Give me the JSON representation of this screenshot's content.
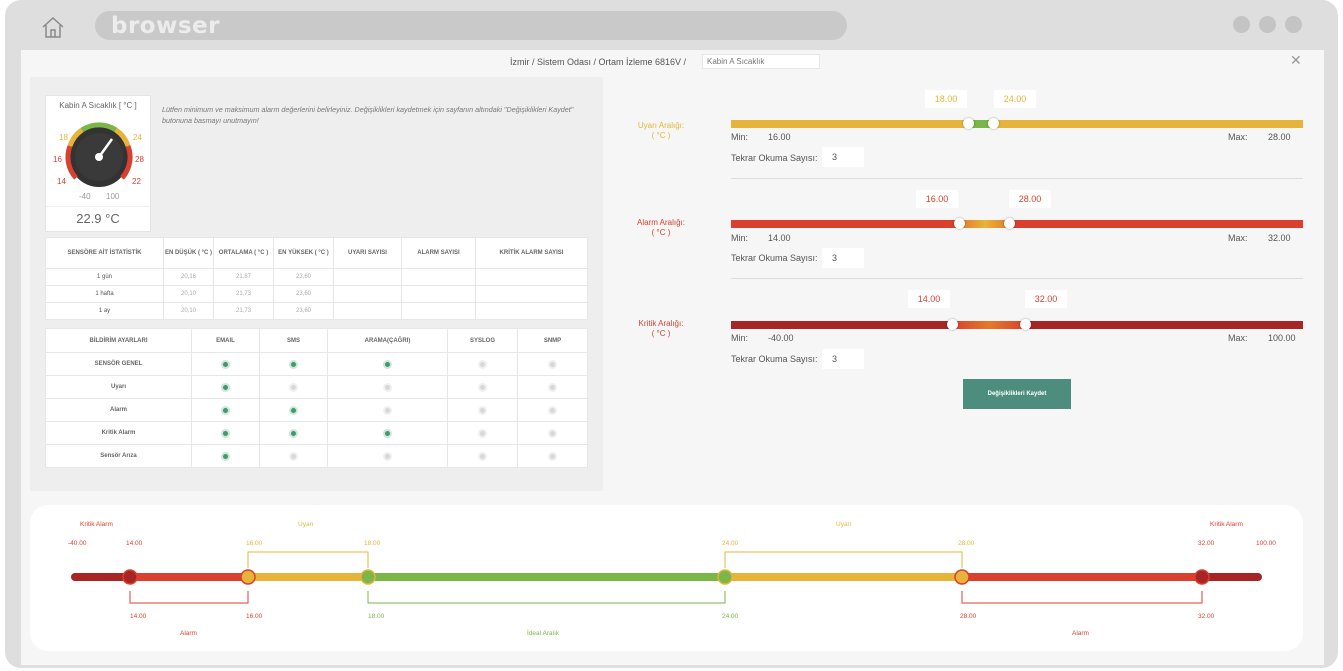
{
  "browser": {
    "url_text": "browser"
  },
  "breadcrumb": {
    "text": "İzmir / Sistem Odası / Ortam İzleme 6816V /",
    "input": "Kabin A Sıcaklık"
  },
  "gauge": {
    "title": "Kabin A Sıcaklık [ °C ]",
    "reading": "22.9 °C",
    "value": 22.9,
    "labels": {
      "l18": "18",
      "l24": "24",
      "l16": "16",
      "l28": "28",
      "l14": "14",
      "l22": "22",
      "lm40": "-40",
      "l100": "100"
    }
  },
  "note": "Lütfen minimum ve maksimum alarm değerlerini belirleyiniz. Değişiklikleri kaydetmek için sayfanın altındaki \"Değişiklikleri Kaydet\" butonuna basmayı unutmayın!",
  "stats": {
    "headers": [
      "SENSÖRE AİT İSTATİSTİK",
      "EN DÜŞÜK ( °C )",
      "ORTALAMA ( °C )",
      "EN YÜKSEK ( °C )",
      "UYARI SAYISI",
      "ALARM SAYISI",
      "KRİTİK ALARM SAYISI"
    ],
    "rows": [
      {
        "label": "1 gün",
        "min": "20,16",
        "avg": "21,87",
        "max": "23,60"
      },
      {
        "label": "1 hafta",
        "min": "20,10",
        "avg": "21,73",
        "max": "23,60"
      },
      {
        "label": "1 ay",
        "min": "20,10",
        "avg": "21,73",
        "max": "23,60"
      }
    ]
  },
  "notif": {
    "headers": [
      "BİLDİRİM AYARLARI",
      "EMAIL",
      "SMS",
      "ARAMA(ÇAĞRI)",
      "SYSLOG",
      "SNMP"
    ],
    "rows": [
      {
        "label": "SENSÖR GENEL",
        "checks": [
          true,
          true,
          true,
          false,
          false
        ]
      },
      {
        "label": "Uyarı",
        "checks": [
          true,
          false,
          false,
          false,
          false
        ]
      },
      {
        "label": "Alarm",
        "checks": [
          true,
          true,
          false,
          false,
          false
        ]
      },
      {
        "label": "Kritik Alarm",
        "checks": [
          true,
          true,
          true,
          false,
          false
        ]
      },
      {
        "label": "Sensör Arıza",
        "checks": [
          true,
          false,
          false,
          false,
          false
        ]
      }
    ]
  },
  "ranges": {
    "min_label": "Min:",
    "max_label": "Max:",
    "repeat_label": "Tekrar Okuma Sayısı:",
    "warning": {
      "label": "Uyarı Aralığı:",
      "unit": "( °C )",
      "low": "18.00",
      "high": "24.00",
      "min": "16.00",
      "max": "28.00",
      "repeat": "3"
    },
    "alarm": {
      "label": "Alarm Aralığı:",
      "unit": "( °C )",
      "low": "16.00",
      "high": "28.00",
      "min": "14.00",
      "max": "32.00",
      "repeat": "3"
    },
    "critical": {
      "label": "Kritik Aralığı:",
      "unit": "( °C )",
      "low": "14.00",
      "high": "32.00",
      "min": "-40.00",
      "max": "100.00",
      "repeat": "3"
    }
  },
  "save_label": "Değişiklikleri Kaydet",
  "scale": {
    "top_labels": {
      "crit_left": "Kritik Alarm",
      "warn_left": "Uyarı",
      "warn_right": "Uyarı",
      "crit_right": "Kritik Alarm"
    },
    "top_values": {
      "v1": "-40.00",
      "v2": "14.00",
      "v3": "16.00",
      "v4": "18.00",
      "v5": "24.00",
      "v6": "28.00",
      "v7": "32.00",
      "v8": "100.00"
    },
    "bottom_values": {
      "b1": "14.00",
      "b2": "16.00",
      "b3": "18.00",
      "b4": "24.00",
      "b5": "28.00",
      "b6": "32.00"
    },
    "bottom_labels": {
      "alarm_left": "Alarm",
      "ideal": "İdeal Aralık",
      "alarm_right": "Alarm"
    }
  },
  "colors": {
    "warning": "#e6b43a",
    "alarm": "#d9402f",
    "critical": "#a72525",
    "ideal": "#7ab648",
    "button": "#4d8d7d"
  }
}
